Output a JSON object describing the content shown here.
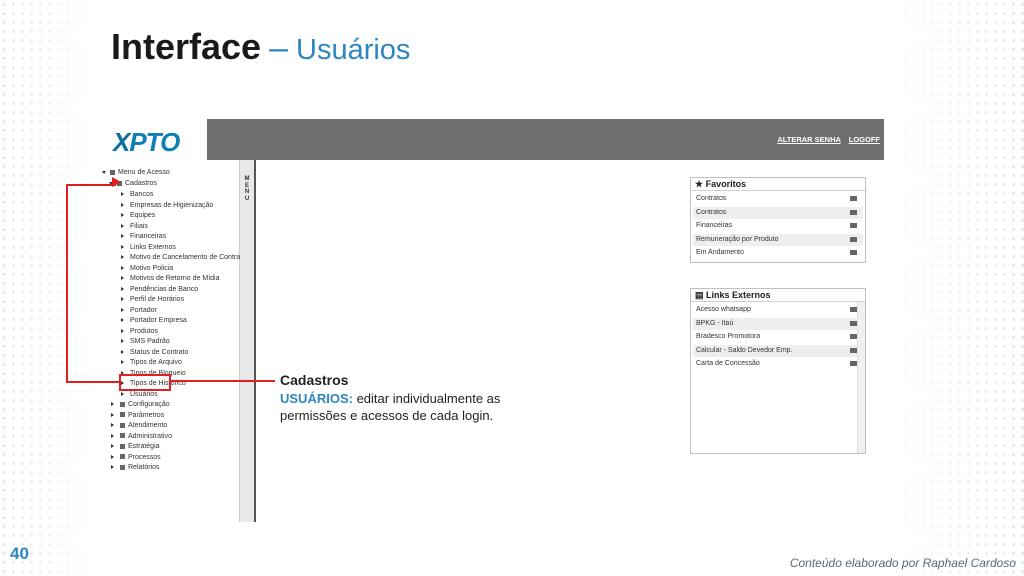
{
  "slide": {
    "title_bold": "Interface",
    "title_dash": "–",
    "title_sub": "Usuários",
    "number": "40",
    "credit": "Conteúdo elaborado por Raphael Cardoso"
  },
  "app": {
    "logo": {
      "part1": "X",
      "part2": "PTO"
    },
    "top_links": [
      "ALTERAR SENHA",
      "LOGOFF"
    ],
    "menu_tab_letters": [
      "M",
      "E",
      "N",
      "U"
    ],
    "tree": {
      "root": "Menu de Acesso",
      "group": "Cadastros",
      "cadastros_items": [
        "Bancos",
        "Empresas de Higienização",
        "Equipes",
        "Filiais",
        "Financeiras",
        "Links Externos",
        "Motivo de Cancelamento de Contrato",
        "Motivo Policia",
        "Motivos de Retorno de Mídia",
        "Pendências de Banco",
        "Perfil de Horários",
        "Portador",
        "Portador Empresa",
        "Produtos",
        "SMS Padrão",
        "Status de Contrato",
        "Tipos de Arquivo",
        "Tipos de Bloqueio",
        "Tipos de Histórico",
        "Usuários"
      ],
      "other_sections": [
        "Configuração",
        "Parâmetros",
        "Atendimento",
        "Administrativo",
        "Estratégia",
        "Processos",
        "Relatórios"
      ]
    },
    "favoritos": {
      "title": "Favoritos",
      "items": [
        "Contratos",
        "Contratos",
        "Financeiras",
        "Remuneração por Produto",
        "Em Andamento"
      ]
    },
    "links_externos": {
      "title": "Links Externos",
      "items": [
        "Acesso whatsapp",
        "BPKG - Itaú",
        "Bradesco Promotora",
        "Calcular - Saldo Devedor Emp.",
        "Carta de Concessão"
      ]
    }
  },
  "callout": {
    "heading": "Cadastros",
    "keyword": "USUÁRIOS:",
    "text": "editar individualmente as permissões e acessos de cada login."
  }
}
